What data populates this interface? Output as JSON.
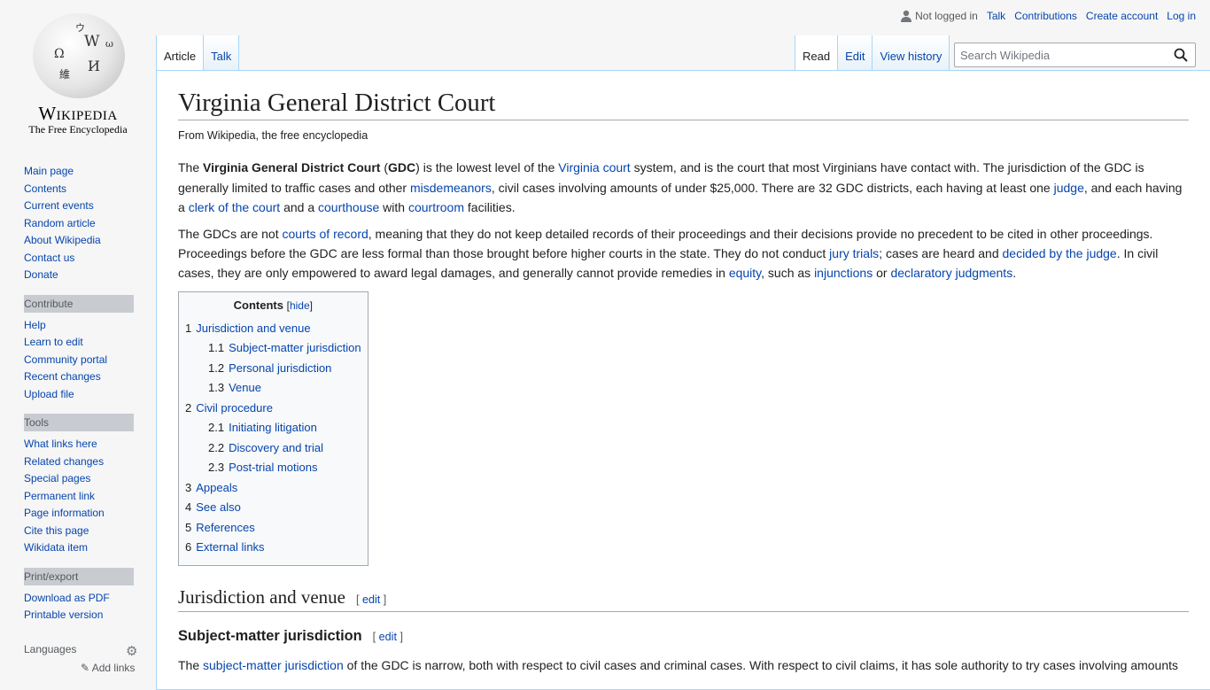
{
  "logo": {
    "wordmark": "Wikipedia",
    "tagline": "The Free Encyclopedia"
  },
  "sidebar": {
    "navigation": [
      "Main page",
      "Contents",
      "Current events",
      "Random article",
      "About Wikipedia",
      "Contact us",
      "Donate"
    ],
    "contribute": {
      "heading": "Contribute",
      "items": [
        "Help",
        "Learn to edit",
        "Community portal",
        "Recent changes",
        "Upload file"
      ]
    },
    "tools": {
      "heading": "Tools",
      "items": [
        "What links here",
        "Related changes",
        "Special pages",
        "Permanent link",
        "Page information",
        "Cite this page",
        "Wikidata item"
      ]
    },
    "print": {
      "heading": "Print/export",
      "items": [
        "Download as PDF",
        "Printable version"
      ]
    },
    "languages": {
      "heading": "Languages",
      "add_links": "Add links"
    }
  },
  "personal": {
    "not_logged_in": "Not logged in",
    "talk": "Talk",
    "contributions": "Contributions",
    "create_account": "Create account",
    "login": "Log in"
  },
  "tabs": {
    "article": "Article",
    "talk": "Talk",
    "read": "Read",
    "edit": "Edit",
    "history": "View history"
  },
  "search": {
    "placeholder": "Search Wikipedia"
  },
  "article": {
    "title": "Virginia General District Court",
    "site_sub": "From Wikipedia, the free encyclopedia",
    "p1": {
      "t1": "The ",
      "b1": "Virginia General District Court",
      "t2": " (",
      "b2": "GDC",
      "t3": ") is the lowest level of the ",
      "l1": "Virginia court",
      "t4": " system, and is the court that most Virginians have contact with. The jurisdiction of the GDC is generally limited to traffic cases and other ",
      "l2": "misdemeanors",
      "t5": ", civil cases involving amounts of under $25,000. There are 32 GDC districts, each having at least one ",
      "l3": "judge",
      "t6": ", and each having a ",
      "l4": "clerk of the court",
      "t7": " and a ",
      "l5": "courthouse",
      "t8": " with ",
      "l6": "courtroom",
      "t9": " facilities."
    },
    "p2": {
      "t1": "The GDCs are not ",
      "l1": "courts of record",
      "t2": ", meaning that they do not keep detailed records of their proceedings and their decisions provide no precedent to be cited in other proceedings. Proceedings before the GDC are less formal than those brought before higher courts in the state. They do not conduct ",
      "l2": "jury trials",
      "t3": "; cases are heard and ",
      "l3": "decided by the judge",
      "t4": ". In civil cases, they are only empowered to award legal damages, and generally cannot provide remedies in ",
      "l4": "equity",
      "t5": ", such as ",
      "l5": "injunctions",
      "t6": " or ",
      "l6": "declaratory judgments",
      "t7": "."
    },
    "toc": {
      "title": "Contents",
      "hide": "hide",
      "items": [
        {
          "num": "1",
          "label": "Jurisdiction and venue",
          "sub": false
        },
        {
          "num": "1.1",
          "label": "Subject-matter jurisdiction",
          "sub": true
        },
        {
          "num": "1.2",
          "label": "Personal jurisdiction",
          "sub": true
        },
        {
          "num": "1.3",
          "label": "Venue",
          "sub": true
        },
        {
          "num": "2",
          "label": "Civil procedure",
          "sub": false
        },
        {
          "num": "2.1",
          "label": "Initiating litigation",
          "sub": true
        },
        {
          "num": "2.2",
          "label": "Discovery and trial",
          "sub": true
        },
        {
          "num": "2.3",
          "label": "Post-trial motions",
          "sub": true
        },
        {
          "num": "3",
          "label": "Appeals",
          "sub": false
        },
        {
          "num": "4",
          "label": "See also",
          "sub": false
        },
        {
          "num": "5",
          "label": "References",
          "sub": false
        },
        {
          "num": "6",
          "label": "External links",
          "sub": false
        }
      ]
    },
    "h2": "Jurisdiction and venue",
    "h3": "Subject-matter jurisdiction",
    "edit_label": "edit",
    "p3": {
      "t1": "The ",
      "l1": "subject-matter jurisdiction",
      "t2": " of the GDC is narrow, both with respect to civil cases and criminal cases. With respect to civil claims, it has sole authority to try cases involving amounts"
    }
  }
}
